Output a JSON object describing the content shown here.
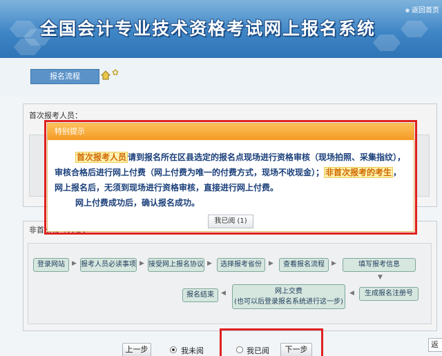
{
  "header": {
    "title": "全国会计专业技术资格考试网上报名系统",
    "return_link": "返回首页"
  },
  "breadcrumb": {
    "current": "报名流程"
  },
  "section_first": {
    "title": "首次报考人员："
  },
  "section_nonfirst": {
    "title": "非首次报考人员："
  },
  "flow_steps": [
    "登录网站",
    "报考人员必读事项",
    "接受网上报名协议",
    "选择报考省份",
    "查看报名流程",
    "填写报考信息",
    "生成报名注册号",
    "网上交费",
    "(也可以后登录报名系统进行这一步)",
    "报名结束"
  ],
  "modal": {
    "title": "特别提示",
    "p1_hl": "首次报考人员",
    "p1_text": "请到报名所在区县选定的报名点现场进行资格审核（现场拍照、采集指纹），审核合格后进行网上付费（网上付费为唯一的付费方式，现场不收现金）；",
    "p1_hl2": "非首次报考的考生",
    "p1_text2": "，网上报名后，无须到现场进行资格审核，直接进行网上付费。",
    "p2_text": "网上付费成功后，确认报名成功。",
    "ack_button": "我已阅 (1)"
  },
  "bottom": {
    "prev": "上一步",
    "not_read": "我未阅",
    "read": "我已阅",
    "next": "下一步",
    "right_edge": "返"
  },
  "colors": {
    "banner": "#3f86c6",
    "modal_header": "#f39a24",
    "highlight_red": "#e02020",
    "step_fill": "#d6e7df"
  }
}
